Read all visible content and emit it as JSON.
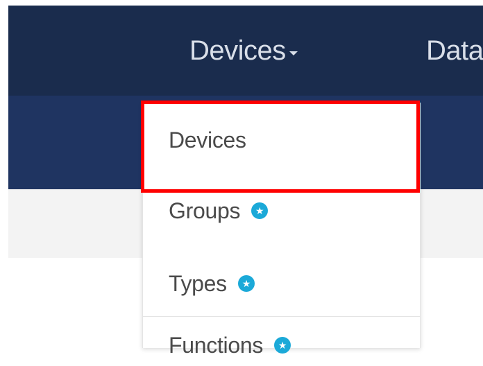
{
  "navbar": {
    "items": [
      {
        "label": "Devices"
      },
      {
        "label": "Data"
      }
    ]
  },
  "dropdown": {
    "items": [
      {
        "label": "Devices",
        "has_badge": false
      },
      {
        "label": "Groups",
        "has_badge": true,
        "badge_icon": "star-icon"
      },
      {
        "label": "Types",
        "has_badge": true,
        "badge_icon": "star-icon"
      },
      {
        "label": "Functions",
        "has_badge": true,
        "badge_icon": "star-icon"
      }
    ]
  },
  "colors": {
    "navbar_bg": "#1a2c4d",
    "subbar_bg": "#1f3461",
    "greybar_bg": "#f3f3f3",
    "badge": "#1ba9d8",
    "highlight": "#ff0000",
    "menu_text": "#4a4a4a"
  }
}
